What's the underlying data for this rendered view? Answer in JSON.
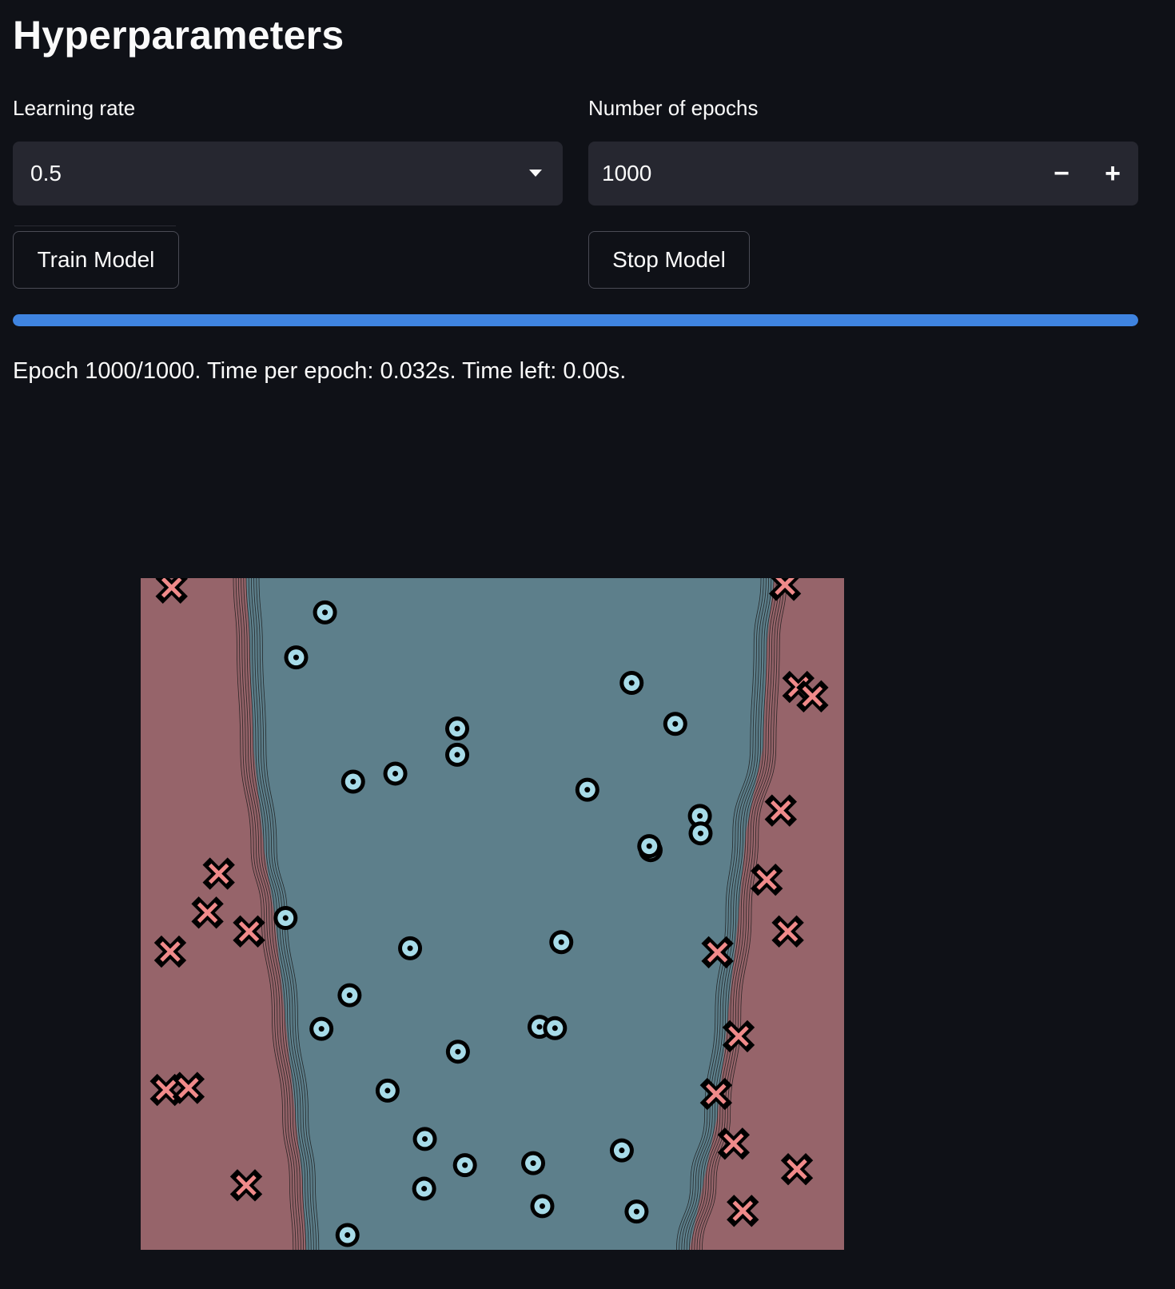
{
  "page": {
    "title": "Hyperparameters"
  },
  "learning_rate": {
    "label": "Learning rate",
    "value": "0.5",
    "icon": "chevron-down-icon"
  },
  "epochs": {
    "label": "Number of epochs",
    "value": "1000",
    "minus_label": "−",
    "plus_label": "+"
  },
  "buttons": {
    "train": "Train Model",
    "stop": "Stop Model"
  },
  "progress": {
    "fraction": 1.0,
    "color": "#3f84e0"
  },
  "status": "Epoch 1000/1000. Time per epoch: 0.032s. Time left: 0.00s.",
  "plot": {
    "colors": {
      "region_outer": "#96646a",
      "region_inner": "#5d7f8b",
      "contour": "#1a1a1a",
      "class_circle_fill": "#a7dbe8",
      "class_cross_fill": "#f08a8a",
      "marker_edge": "#000000"
    },
    "xlim": [
      0,
      1
    ],
    "ylim": [
      0,
      1
    ],
    "boundary_left": [
      [
        0.15,
        1.0
      ],
      [
        0.155,
        0.9
      ],
      [
        0.16,
        0.75
      ],
      [
        0.175,
        0.6
      ],
      [
        0.19,
        0.5
      ],
      [
        0.205,
        0.35
      ],
      [
        0.22,
        0.2
      ],
      [
        0.23,
        0.1
      ],
      [
        0.235,
        0.0
      ]
    ],
    "boundary_right": [
      [
        0.9,
        1.0
      ],
      [
        0.89,
        0.9
      ],
      [
        0.885,
        0.75
      ],
      [
        0.86,
        0.62
      ],
      [
        0.85,
        0.5
      ],
      [
        0.835,
        0.35
      ],
      [
        0.82,
        0.2
      ],
      [
        0.8,
        0.1
      ],
      [
        0.78,
        0.0
      ]
    ],
    "circles": [
      [
        0.262,
        0.949
      ],
      [
        0.221,
        0.882
      ],
      [
        0.45,
        0.776
      ],
      [
        0.45,
        0.737
      ],
      [
        0.302,
        0.697
      ],
      [
        0.362,
        0.709
      ],
      [
        0.698,
        0.844
      ],
      [
        0.76,
        0.783
      ],
      [
        0.635,
        0.685
      ],
      [
        0.795,
        0.646
      ],
      [
        0.796,
        0.62
      ],
      [
        0.725,
        0.595
      ],
      [
        0.723,
        0.601
      ],
      [
        0.206,
        0.494
      ],
      [
        0.383,
        0.449
      ],
      [
        0.598,
        0.458
      ],
      [
        0.297,
        0.379
      ],
      [
        0.257,
        0.329
      ],
      [
        0.451,
        0.295
      ],
      [
        0.567,
        0.332
      ],
      [
        0.589,
        0.33
      ],
      [
        0.351,
        0.237
      ],
      [
        0.404,
        0.165
      ],
      [
        0.461,
        0.126
      ],
      [
        0.403,
        0.091
      ],
      [
        0.558,
        0.129
      ],
      [
        0.684,
        0.148
      ],
      [
        0.571,
        0.065
      ],
      [
        0.705,
        0.057
      ],
      [
        0.294,
        0.022
      ]
    ],
    "crosses": [
      [
        0.044,
        0.986
      ],
      [
        0.916,
        0.99
      ],
      [
        0.935,
        0.838
      ],
      [
        0.955,
        0.824
      ],
      [
        0.91,
        0.654
      ],
      [
        0.89,
        0.551
      ],
      [
        0.111,
        0.56
      ],
      [
        0.095,
        0.502
      ],
      [
        0.154,
        0.474
      ],
      [
        0.042,
        0.444
      ],
      [
        0.92,
        0.474
      ],
      [
        0.82,
        0.443
      ],
      [
        0.85,
        0.318
      ],
      [
        0.818,
        0.232
      ],
      [
        0.843,
        0.158
      ],
      [
        0.933,
        0.12
      ],
      [
        0.036,
        0.238
      ],
      [
        0.068,
        0.241
      ],
      [
        0.15,
        0.096
      ],
      [
        0.856,
        0.058
      ]
    ]
  }
}
